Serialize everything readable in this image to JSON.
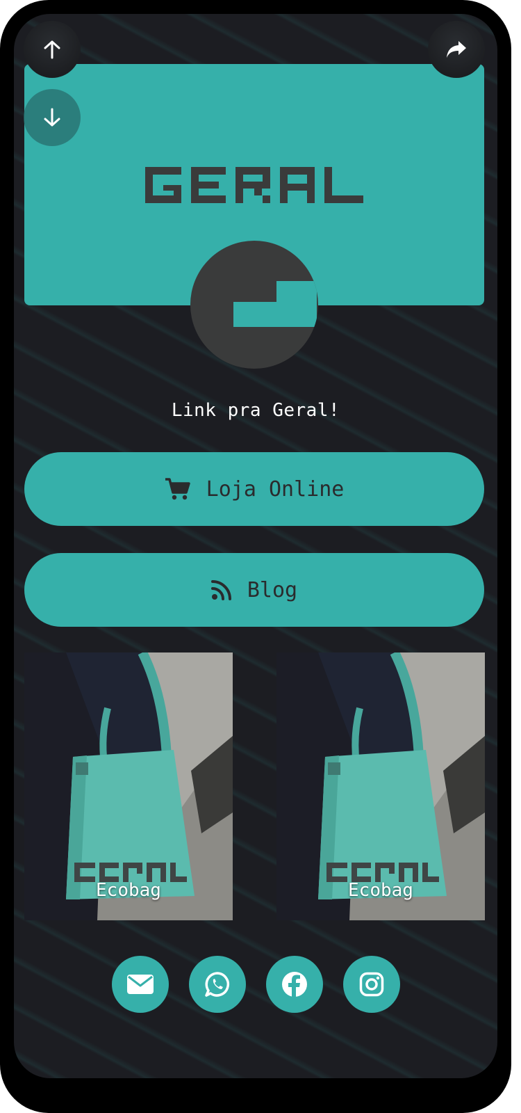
{
  "profile": {
    "tagline": "Link pra Geral!",
    "brand_name": "GERAL"
  },
  "links": [
    {
      "label": "Loja Online",
      "icon": "shopping-cart-icon"
    },
    {
      "label": "Blog",
      "icon": "rss-icon"
    }
  ],
  "products": [
    {
      "title": "Ecobag",
      "image": "teal tote bag with GERAL print"
    },
    {
      "title": "Ecobag",
      "image": "teal tote bag with GERAL print"
    }
  ],
  "socials": [
    "email-icon",
    "whatsapp-icon",
    "facebook-icon",
    "instagram-icon"
  ],
  "colors": {
    "accent": "#36b0aa",
    "background": "#1c1d22",
    "dark_text": "#2a2b2d",
    "avatar_bg": "#3a3b3b"
  }
}
